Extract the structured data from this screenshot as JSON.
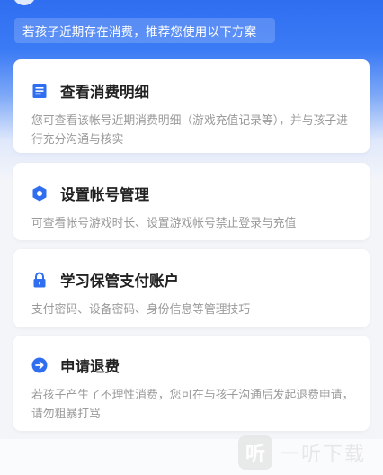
{
  "banner": {
    "text": "若孩子近期存在消费，推荐您使用以下方案"
  },
  "cards": [
    {
      "icon": "document-icon",
      "title": "查看消费明细",
      "desc": "您可查看该帐号近期消费明细（游戏充值记录等），并与孩子进行充分沟通与核实"
    },
    {
      "icon": "hexagon-shield-icon",
      "title": "设置帐号管理",
      "desc": "可查看帐号游戏时长、设置游戏帐号禁止登录与充值"
    },
    {
      "icon": "lock-icon",
      "title": "学习保管支付账户",
      "desc": "支付密码、设备密码、身份信息等管理技巧"
    },
    {
      "icon": "arrow-right-circle-icon",
      "title": "申请退费",
      "desc": "若孩子产生了不理性消费，您可在与孩子沟通后发起退费申请，请勿粗暴打骂"
    }
  ],
  "watermark": {
    "glyph": "听",
    "text": "一听下载"
  },
  "colors": {
    "accent": "#2f6ef0",
    "title": "#222222",
    "desc": "#9a9a9a"
  }
}
